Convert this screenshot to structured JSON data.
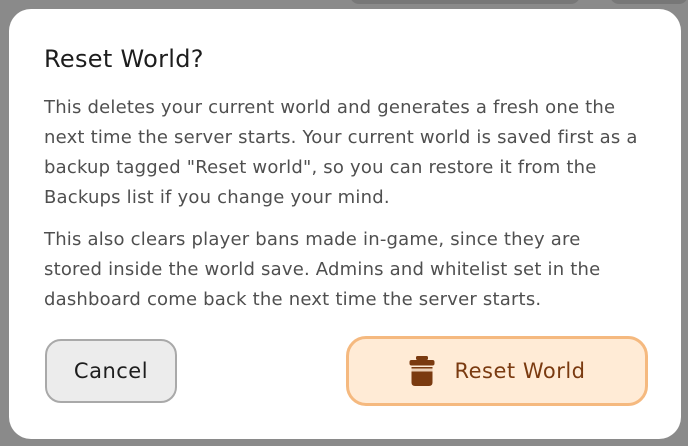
{
  "dialog": {
    "title": "Reset World?",
    "paragraphs": [
      "This deletes your current world and generates a fresh one the next time the server starts. Your current world is saved first as a backup tagged \"Reset world\", so you can restore it from the Backups list if you change your mind.",
      "This also clears player bans made in-game, since they are stored inside the world save. Admins and whitelist set in the dashboard come back the next time the server starts."
    ],
    "cancel_label": "Cancel",
    "confirm_label": "Reset World",
    "confirm_icon": "trash-icon"
  },
  "colors": {
    "confirm_bg": "#ffebd6",
    "confirm_border": "#f5b97f",
    "confirm_text": "#7a3a10",
    "cancel_bg": "#ececec",
    "overlay": "#8d8d8d"
  }
}
